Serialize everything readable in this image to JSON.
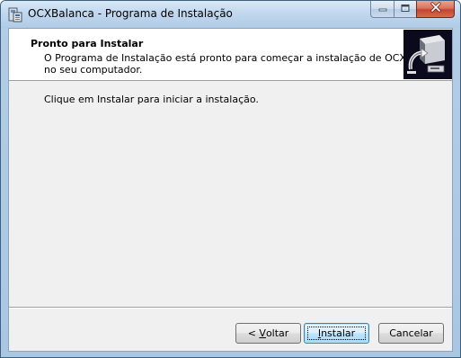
{
  "window": {
    "title": "OCXBalanca - Programa de Instalação"
  },
  "header": {
    "title": "Pronto para Instalar",
    "subtitle_line1": "O Programa de Instalação está pronto para começar a instalação de OCXBalanca",
    "subtitle_line2": "no seu computador."
  },
  "body": {
    "instruction": "Clique em Instalar para iniciar a instalação."
  },
  "buttons": {
    "back_prefix": "< ",
    "back_accel": "V",
    "back_rest": "oltar",
    "install_accel": "I",
    "install_rest": "nstalar",
    "cancel_label": "Cancelar"
  },
  "icons": {
    "app": "setup-app-icon",
    "minimize": "minimize-icon",
    "maximize": "maximize-icon",
    "close": "close-icon",
    "wizard": "computer-install-icon"
  },
  "colors": {
    "title_gradient_top": "#d9e8f6",
    "close_button": "#c2452f",
    "default_button_border": "#3c7fb1",
    "wizard_image_bg": "#0a0a1c"
  }
}
